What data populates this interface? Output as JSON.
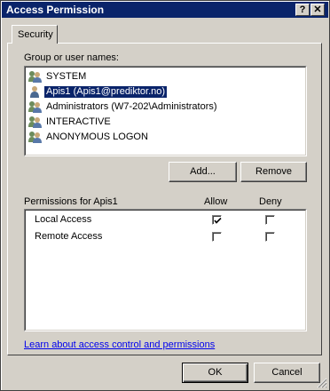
{
  "window": {
    "title": "Access Permission",
    "help_button": "?",
    "close_button": "✕"
  },
  "tabs": [
    {
      "label": "Security",
      "selected": true
    }
  ],
  "group_users": {
    "label": "Group or user names:",
    "items": [
      {
        "name": "SYSTEM",
        "icon": "user-group-icon",
        "selected": false
      },
      {
        "name": "Apis1 (Apis1@prediktor.no)",
        "icon": "user-icon",
        "selected": true
      },
      {
        "name": "Administrators (W7-202\\Administrators)",
        "icon": "user-group-icon",
        "selected": false
      },
      {
        "name": "INTERACTIVE",
        "icon": "user-group-icon",
        "selected": false
      },
      {
        "name": "ANONYMOUS LOGON",
        "icon": "user-group-icon",
        "selected": false
      }
    ],
    "add_label": "Add...",
    "remove_label": "Remove"
  },
  "permissions": {
    "header_label": "Permissions for Apis1",
    "allow_label": "Allow",
    "deny_label": "Deny",
    "rows": [
      {
        "name": "Local Access",
        "allow": true,
        "deny": false
      },
      {
        "name": "Remote Access",
        "allow": false,
        "deny": false
      }
    ]
  },
  "learn_link": "Learn about access control and permissions",
  "footer": {
    "ok_label": "OK",
    "cancel_label": "Cancel"
  }
}
